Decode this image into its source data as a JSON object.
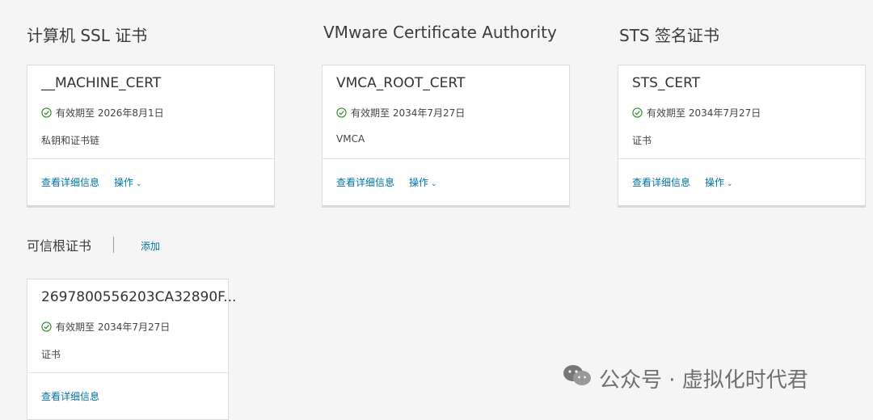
{
  "sections": [
    {
      "title": "计算机 SSL 证书",
      "card": {
        "name": "__MACHINE_CERT",
        "validity": "有效期至 2026年8月1日",
        "description": "私钥和证书链",
        "details_link": "查看详细信息",
        "actions_label": "操作"
      }
    },
    {
      "title": "VMware Certificate Authority",
      "card": {
        "name": "VMCA_ROOT_CERT",
        "validity": "有效期至 2034年7月27日",
        "description": "VMCA",
        "details_link": "查看详细信息",
        "actions_label": "操作"
      }
    },
    {
      "title": "STS 签名证书",
      "card": {
        "name": "STS_CERT",
        "validity": "有效期至 2034年7月27日",
        "description": "证书",
        "details_link": "查看详细信息",
        "actions_label": "操作"
      }
    }
  ],
  "trusted_root": {
    "title": "可信根证书",
    "add_link": "添加",
    "card": {
      "name": "2697800556203CA32890F...",
      "validity": "有效期至 2034年7月27日",
      "description": "证书",
      "details_link": "查看详细信息"
    }
  },
  "watermark": "公众号 · 虚拟化时代君",
  "colors": {
    "link": "#0072a3",
    "valid": "#2e8a2e",
    "background": "#f5f5f5"
  }
}
